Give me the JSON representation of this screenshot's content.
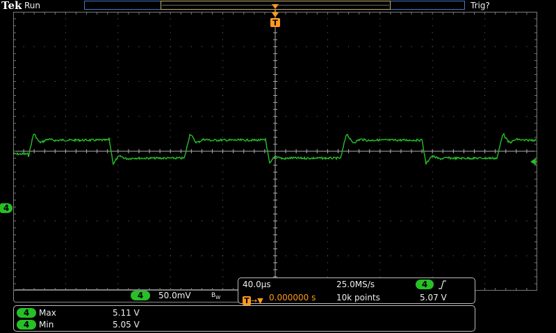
{
  "header": {
    "brand": "Tek",
    "acq_status": "Run",
    "trigger_status": "Trig?"
  },
  "trigger_marker": {
    "label": "T"
  },
  "channel": {
    "number": "4",
    "color": "#27c027",
    "scale": "50.0mV",
    "bw_limit": "B",
    "bw_sub": "W"
  },
  "horizontal": {
    "scale": "40.0μs",
    "sample_rate": "25.0MS/s",
    "delay": "0.000000 s",
    "record_length": "10k points",
    "trigger_source": "4",
    "trigger_slope": "rising-edge",
    "trigger_level": "5.07 V",
    "trigger_icon_label": "T"
  },
  "measurements": [
    {
      "source": "4",
      "name": "Max",
      "value": "5.11 V"
    },
    {
      "source": "4",
      "name": "Min",
      "value": "5.05 V"
    }
  ],
  "colors": {
    "trace": "#27c027",
    "trigger": "#ff9a1e",
    "record_bar": "#4a78c8",
    "graticule": "#7a7a7a"
  }
}
